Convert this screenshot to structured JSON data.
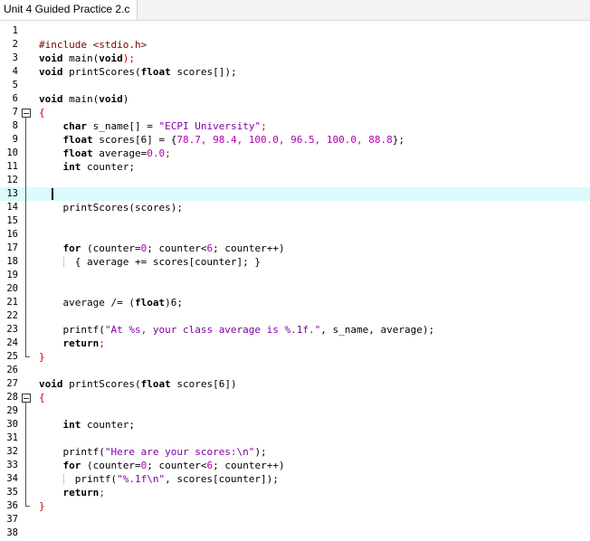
{
  "tab": {
    "title": "Unit 4 Guided Practice 2.c"
  },
  "editor": {
    "current_line": 13,
    "fold_markers": [
      7,
      28
    ],
    "lines": [
      [
        {
          "t": "",
          "c": ""
        }
      ],
      [
        {
          "t": "#include <stdio.h>",
          "c": "pp"
        }
      ],
      [
        {
          "t": "void",
          "c": "kw"
        },
        {
          "t": " main(",
          "c": ""
        },
        {
          "t": "void",
          "c": "kw"
        },
        {
          "t": ");",
          "c": "op"
        }
      ],
      [
        {
          "t": "void",
          "c": "kw"
        },
        {
          "t": " printScores(",
          "c": ""
        },
        {
          "t": "float",
          "c": "kw"
        },
        {
          "t": " scores[]);",
          "c": ""
        }
      ],
      [
        {
          "t": "",
          "c": ""
        }
      ],
      [
        {
          "t": "void",
          "c": "kw"
        },
        {
          "t": " main(",
          "c": ""
        },
        {
          "t": "void",
          "c": "kw"
        },
        {
          "t": ")",
          "c": ""
        }
      ],
      [
        {
          "t": "{",
          "c": "op"
        }
      ],
      [
        {
          "t": "    ",
          "c": ""
        },
        {
          "t": "char",
          "c": "kw"
        },
        {
          "t": " s_name[] = ",
          "c": ""
        },
        {
          "t": "\"ECPI University\"",
          "c": "str"
        },
        {
          "t": ";",
          "c": "op"
        }
      ],
      [
        {
          "t": "    ",
          "c": ""
        },
        {
          "t": "float",
          "c": "kw"
        },
        {
          "t": " scores[6] = {",
          "c": ""
        },
        {
          "t": "78.7, 98.4, 100.0, 96.5, 100.0, 88.8",
          "c": "num"
        },
        {
          "t": "};",
          "c": ""
        }
      ],
      [
        {
          "t": "    ",
          "c": ""
        },
        {
          "t": "float",
          "c": "kw"
        },
        {
          "t": " average=",
          "c": ""
        },
        {
          "t": "0.0",
          "c": "num"
        },
        {
          "t": ";",
          "c": "op"
        }
      ],
      [
        {
          "t": "    ",
          "c": ""
        },
        {
          "t": "int",
          "c": "kw"
        },
        {
          "t": " counter;",
          "c": ""
        }
      ],
      [
        {
          "t": "",
          "c": ""
        }
      ],
      [
        {
          "t": "",
          "c": ""
        }
      ],
      [
        {
          "t": "    printScores(scores);",
          "c": ""
        }
      ],
      [
        {
          "t": "",
          "c": ""
        }
      ],
      [
        {
          "t": "",
          "c": ""
        }
      ],
      [
        {
          "t": "    ",
          "c": ""
        },
        {
          "t": "for",
          "c": "kw"
        },
        {
          "t": " (counter=",
          "c": ""
        },
        {
          "t": "0",
          "c": "num"
        },
        {
          "t": "; counter<",
          "c": ""
        },
        {
          "t": "6",
          "c": "num"
        },
        {
          "t": "; counter++)",
          "c": ""
        }
      ],
      [
        {
          "t": "      { average += scores[counter]; }",
          "c": ""
        }
      ],
      [
        {
          "t": "",
          "c": ""
        }
      ],
      [
        {
          "t": "",
          "c": ""
        }
      ],
      [
        {
          "t": "    average /= (",
          "c": ""
        },
        {
          "t": "float",
          "c": "kw"
        },
        {
          "t": ")6;",
          "c": ""
        }
      ],
      [
        {
          "t": "",
          "c": ""
        }
      ],
      [
        {
          "t": "    printf(",
          "c": ""
        },
        {
          "t": "\"At %s, your class average is %.1f.\"",
          "c": "str"
        },
        {
          "t": ", s_name, average);",
          "c": ""
        }
      ],
      [
        {
          "t": "    ",
          "c": ""
        },
        {
          "t": "return",
          "c": "kw"
        },
        {
          "t": ";",
          "c": "op"
        }
      ],
      [
        {
          "t": "}",
          "c": "op"
        }
      ],
      [
        {
          "t": "",
          "c": ""
        }
      ],
      [
        {
          "t": "void",
          "c": "kw"
        },
        {
          "t": " printScores(",
          "c": ""
        },
        {
          "t": "float",
          "c": "kw"
        },
        {
          "t": " scores[6])",
          "c": ""
        }
      ],
      [
        {
          "t": "{",
          "c": "op"
        }
      ],
      [
        {
          "t": "",
          "c": ""
        }
      ],
      [
        {
          "t": "    ",
          "c": ""
        },
        {
          "t": "int",
          "c": "kw"
        },
        {
          "t": " counter;",
          "c": ""
        }
      ],
      [
        {
          "t": "",
          "c": ""
        }
      ],
      [
        {
          "t": "    printf(",
          "c": ""
        },
        {
          "t": "\"Here are your scores:\\n\"",
          "c": "str"
        },
        {
          "t": ");",
          "c": ""
        }
      ],
      [
        {
          "t": "    ",
          "c": ""
        },
        {
          "t": "for",
          "c": "kw"
        },
        {
          "t": " (counter=",
          "c": ""
        },
        {
          "t": "0",
          "c": "num"
        },
        {
          "t": "; counter<",
          "c": ""
        },
        {
          "t": "6",
          "c": "num"
        },
        {
          "t": "; counter++)",
          "c": ""
        }
      ],
      [
        {
          "t": "      printf(",
          "c": ""
        },
        {
          "t": "\"%.1f\\n\"",
          "c": "str"
        },
        {
          "t": ", scores[counter]);",
          "c": ""
        }
      ],
      [
        {
          "t": "    ",
          "c": ""
        },
        {
          "t": "return",
          "c": "kw"
        },
        {
          "t": ";",
          "c": "op"
        }
      ],
      [
        {
          "t": "}",
          "c": "op"
        }
      ],
      [
        {
          "t": "",
          "c": ""
        }
      ],
      [
        {
          "t": "",
          "c": ""
        }
      ]
    ]
  }
}
